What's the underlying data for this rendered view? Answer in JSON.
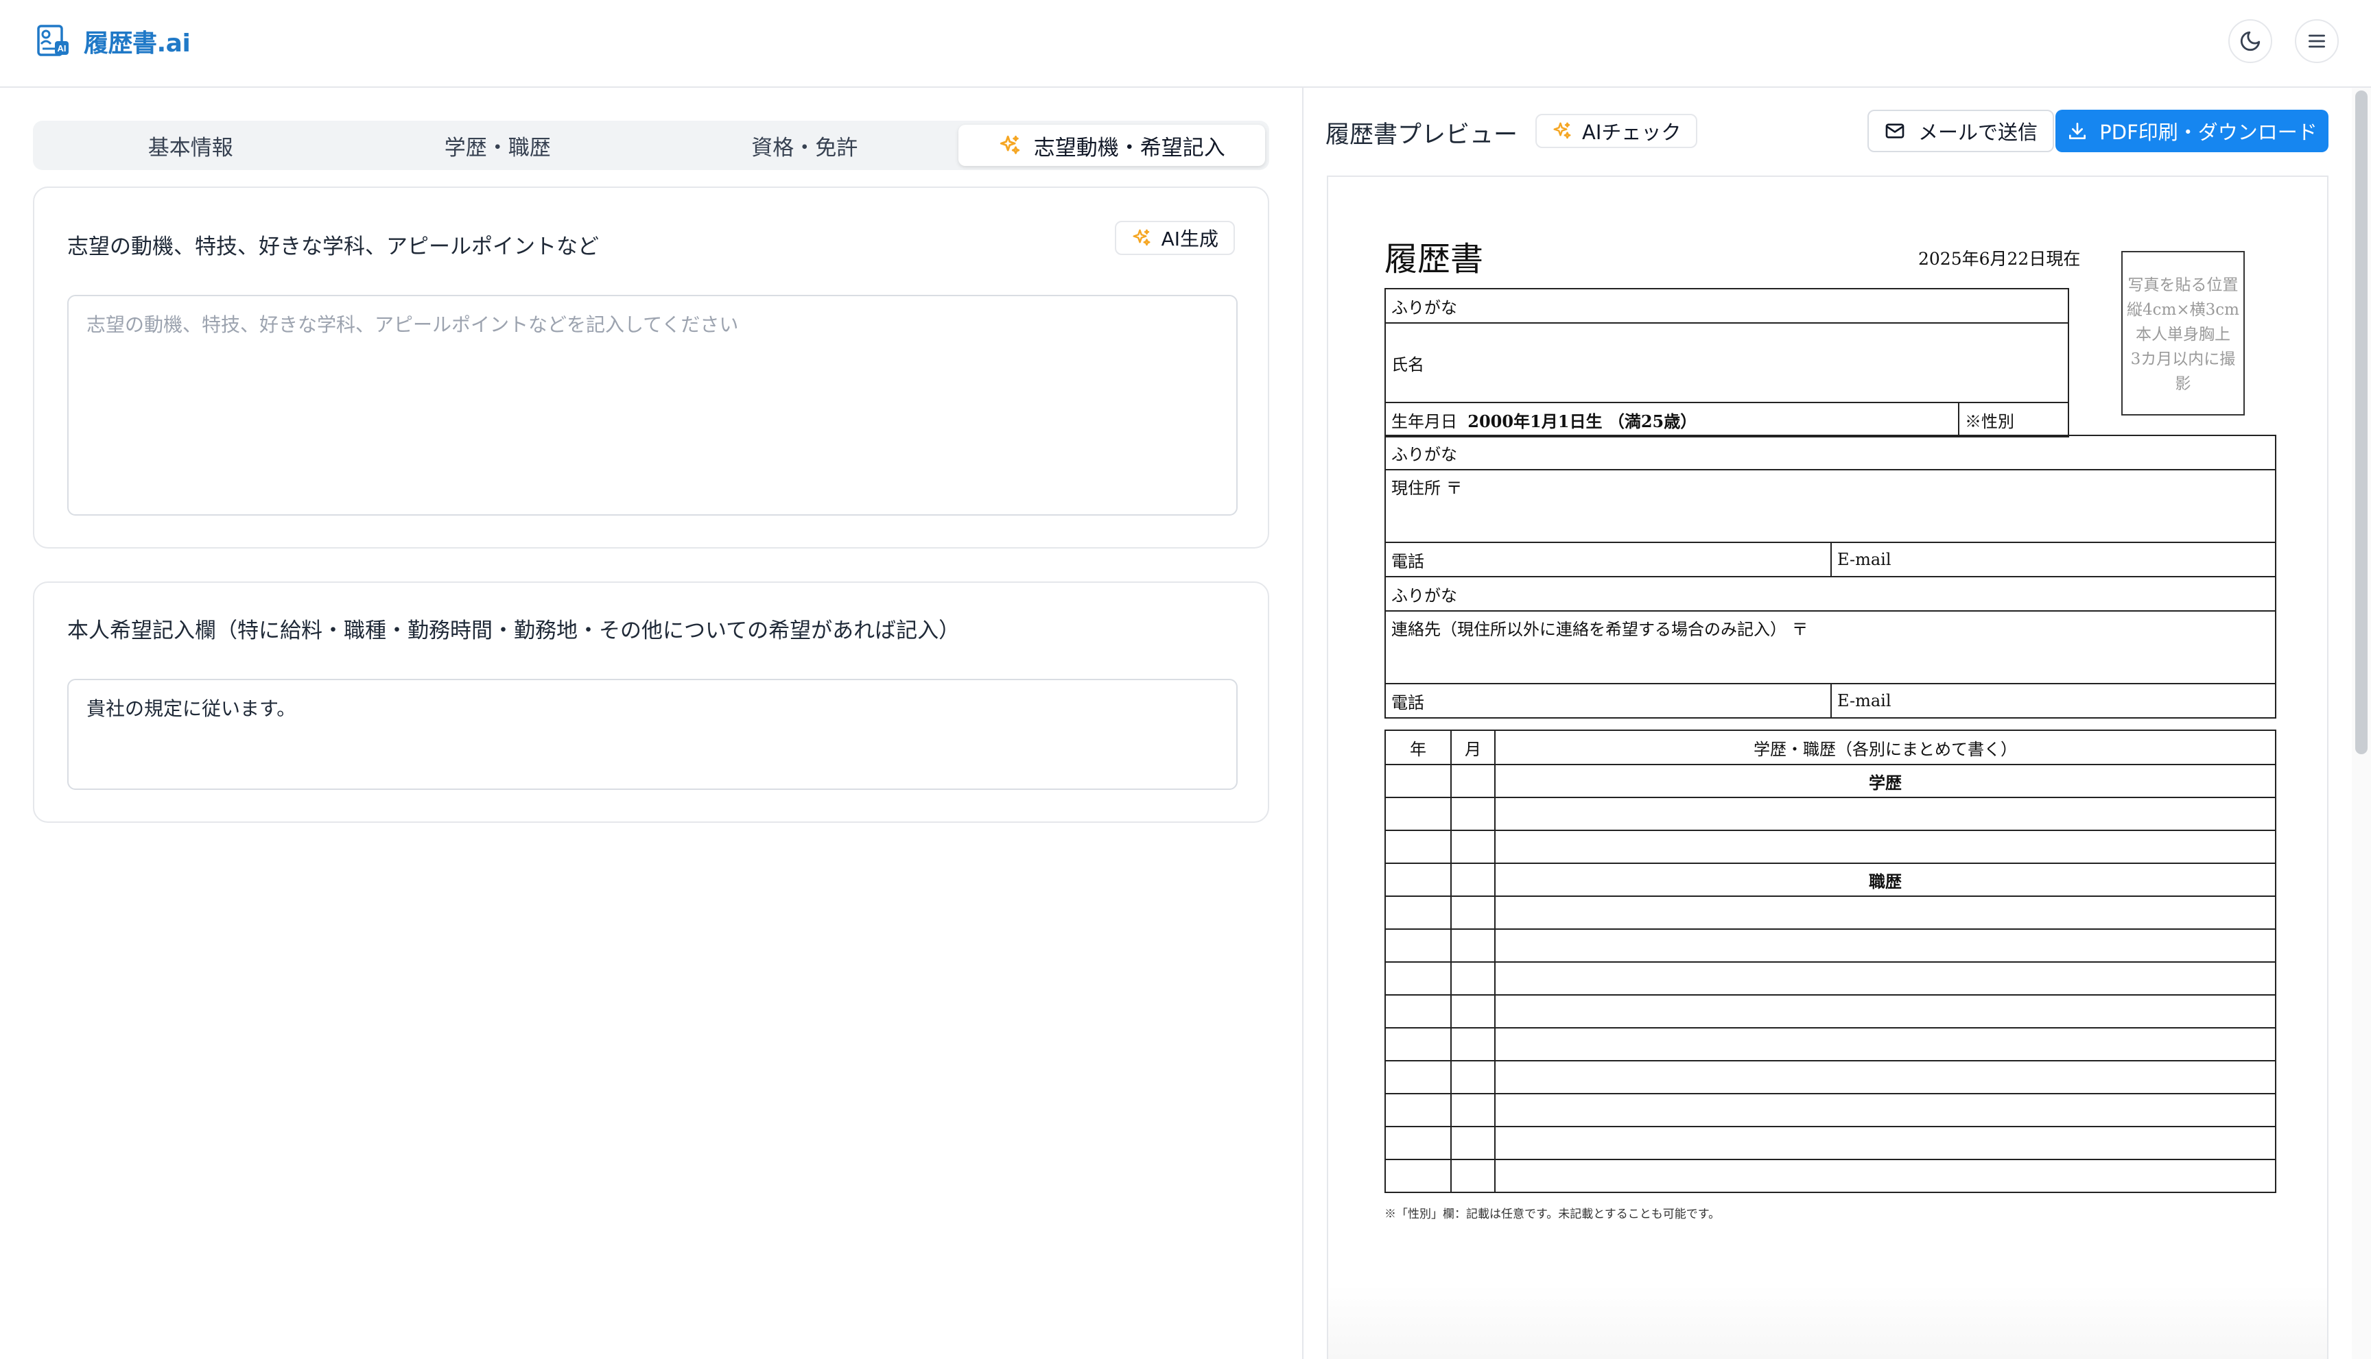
{
  "app": {
    "title": "履歴書.ai"
  },
  "tabs": [
    {
      "label": "基本情報"
    },
    {
      "label": "学歴・職歴"
    },
    {
      "label": "資格・免許"
    },
    {
      "label": "志望動機・希望記入"
    }
  ],
  "motivation": {
    "title": "志望の動機、特技、好きな学科、アピールポイントなど",
    "ai_button": "AI生成",
    "placeholder": "志望の動機、特技、好きな学科、アピールポイントなどを記入してください",
    "value": ""
  },
  "request": {
    "title": "本人希望記入欄（特に給料・職種・勤務時間・勤務地・その他についての希望があれば記入）",
    "value": "貴社の規定に従います。"
  },
  "preview": {
    "title": "履歴書プレビュー",
    "ai_check": "AIチェック",
    "mail_button": "メールで送信",
    "pdf_button": "PDF印刷・ダウンロード"
  },
  "resume": {
    "title": "履歴書",
    "date": "2025年6月22日現在",
    "photo": [
      "写真を貼る位置",
      "縦4cm×横3cm",
      "本人単身胸上",
      "3カ月以内に撮影"
    ],
    "furigana": "ふりがな",
    "name_label": "氏名",
    "birth_label": "生年月日",
    "birth_value": "2000年1月1日生 （満25歳）",
    "gender_label": "※性別",
    "address_label": "現住所",
    "postal_mark": "〒",
    "phone_label": "電話",
    "email_label": "E-mail",
    "contact_label": "連絡先（現住所以外に連絡を希望する場合のみ記入）",
    "history_year": "年",
    "history_month": "月",
    "history_header": "学歴・職歴（各別にまとめて書く）",
    "education_label": "学歴",
    "work_label": "職歴",
    "note": "※「性別」欄：記載は任意です。未記載とすることも可能です。"
  }
}
